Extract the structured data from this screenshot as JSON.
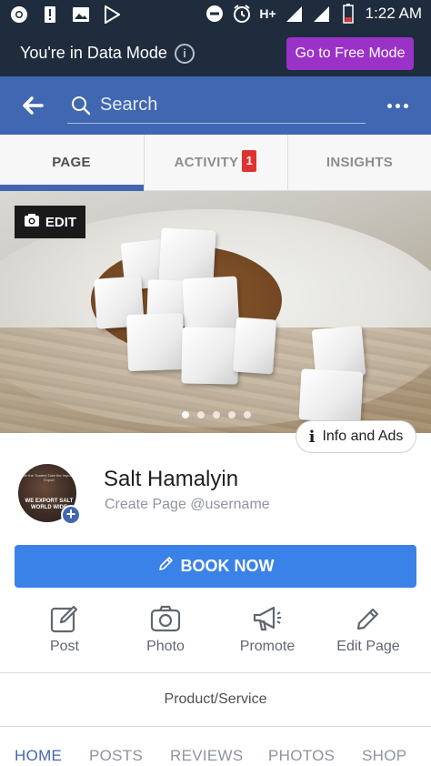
{
  "status_bar": {
    "left_icons": [
      "chrome-icon",
      "alert-icon",
      "image-icon",
      "play-store-icon"
    ],
    "right_icons": [
      "do-not-disturb-icon",
      "alarm-icon",
      "signal-icon",
      "signal-icon",
      "battery-icon"
    ],
    "network": "H+",
    "time": "1:22 AM"
  },
  "data_mode": {
    "message": "You're in Data Mode",
    "button": "Go to Free Mode",
    "accent": "#9b32c8"
  },
  "header": {
    "search_placeholder": "Search",
    "brand_color": "#4267b2"
  },
  "tabs": [
    {
      "label": "PAGE",
      "active": true
    },
    {
      "label": "ACTIVITY",
      "badge": "1"
    },
    {
      "label": "INSIGHTS"
    }
  ],
  "cover": {
    "edit_label": "EDIT",
    "info_ads_label": "Info and Ads",
    "carousel_dots": 5
  },
  "profile": {
    "name": "Salt Hamalyin",
    "username_prompt": "Create Page @username",
    "avatar_text_top": "While the Traders Take the Import and Export",
    "avatar_text_main": "WE EXPORT SALT WORLD WIDE"
  },
  "cta": {
    "label": "BOOK NOW",
    "color": "#3b82e8"
  },
  "actions": [
    {
      "label": "Post",
      "icon": "compose-icon"
    },
    {
      "label": "Photo",
      "icon": "camera-icon"
    },
    {
      "label": "Promote",
      "icon": "megaphone-icon"
    },
    {
      "label": "Edit Page",
      "icon": "pencil-icon"
    }
  ],
  "category": "Product/Service",
  "bottom_tabs": [
    {
      "label": "HOME",
      "active": true
    },
    {
      "label": "POSTS"
    },
    {
      "label": "REVIEWS"
    },
    {
      "label": "PHOTOS"
    },
    {
      "label": "SHOP"
    }
  ]
}
